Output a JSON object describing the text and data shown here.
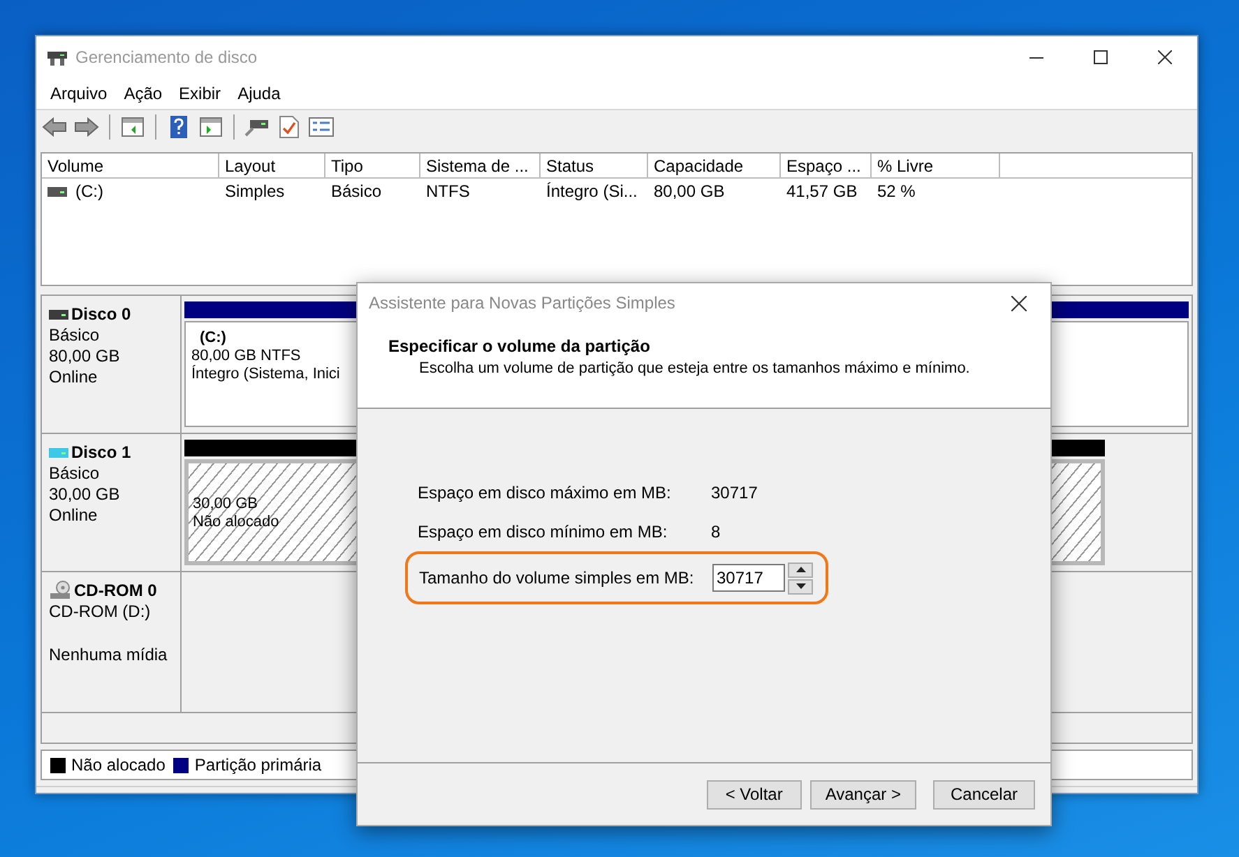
{
  "main_window": {
    "title": "Gerenciamento de disco",
    "menu": [
      "Arquivo",
      "Ação",
      "Exibir",
      "Ajuda"
    ],
    "volume_table": {
      "columns": [
        "Volume",
        "Layout",
        "Tipo",
        "Sistema de ...",
        "Status",
        "Capacidade",
        "Espaço ...",
        "% Livre"
      ],
      "rows": [
        {
          "cells": [
            "(C:)",
            "Simples",
            "Básico",
            "NTFS",
            "Íntegro (Si...",
            "80,00 GB",
            "41,57 GB",
            "52 %"
          ]
        }
      ]
    },
    "disks": [
      {
        "kind": "disk",
        "name": "Disco 0",
        "type": "Básico",
        "size": "80,00 GB",
        "status": "Online",
        "color": "#3c3c3c",
        "partitions": [
          {
            "kind": "primary",
            "title": "(C:)",
            "lines": [
              "80,00 GB NTFS",
              "Íntegro (Sistema, Inici"
            ]
          }
        ]
      },
      {
        "kind": "disk",
        "name": "Disco 1",
        "type": "Básico",
        "size": "30,00 GB",
        "status": "Online",
        "color": "#3cc8e6",
        "partitions": [
          {
            "kind": "unallocated",
            "lines": [
              "30,00 GB",
              "Não alocado"
            ]
          }
        ]
      },
      {
        "kind": "cdrom",
        "name": "CD-ROM 0",
        "type": "CD-ROM (D:)",
        "status": "Nenhuma mídia"
      }
    ],
    "legend": [
      {
        "label": "Não alocado",
        "color": "#000000"
      },
      {
        "label": "Partição primária",
        "color": "#000080"
      }
    ]
  },
  "dialog": {
    "title": "Assistente para Novas Partições Simples",
    "heading": "Especificar o volume da partição",
    "subheading": "Escolha um volume de partição que esteja entre os tamanhos máximo e mínimo.",
    "fields": [
      {
        "kind": "readout",
        "label": "Espaço em disco máximo em MB:",
        "value": "30717"
      },
      {
        "kind": "readout",
        "label": "Espaço em disco mínimo em MB:",
        "value": "8"
      },
      {
        "kind": "spinbox",
        "label": "Tamanho do volume simples em MB:",
        "value": "30717",
        "highlighted": true
      }
    ],
    "buttons": [
      "< Voltar",
      "Avançar >",
      "Cancelar"
    ]
  }
}
